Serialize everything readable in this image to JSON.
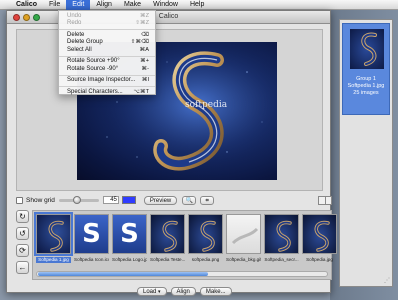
{
  "menubar": {
    "apple": "",
    "app_name": "Calico",
    "items": [
      "File",
      "Edit",
      "Align",
      "Make",
      "Window",
      "Help"
    ],
    "active": "Edit"
  },
  "window": {
    "title": "Calico"
  },
  "edit_menu": {
    "undo": {
      "label": "Undo",
      "shortcut": "⌘Z"
    },
    "redo": {
      "label": "Redo",
      "shortcut": "⇧⌘Z"
    },
    "delete": {
      "label": "Delete",
      "shortcut": "⌫"
    },
    "delete_group": {
      "label": "Delete Group",
      "shortcut": "⇧⌘⌫"
    },
    "select_all": {
      "label": "Select All",
      "shortcut": "⌘A"
    },
    "rotate_plus": {
      "label": "Rotate Source +90°",
      "shortcut": "⌘+"
    },
    "rotate_minus": {
      "label": "Rotate Source -90°",
      "shortcut": "⌘-"
    },
    "inspector": {
      "label": "Source Image Inspector...",
      "shortcut": "⌘I"
    },
    "special_chars": {
      "label": "Special Characters...",
      "shortcut": "⌥⌘T"
    }
  },
  "preview": {
    "watermark": "softpedia",
    "letter": "S"
  },
  "toolbar": {
    "show_grid_label": "Show grid",
    "grid_size": "45",
    "grid_slider_fraction": 0.45,
    "grid_color": "#2f3cff",
    "preview_label": "Preview",
    "zoom_icon": "🔍",
    "crop_icon": "⌗"
  },
  "side_buttons": [
    "↻",
    "↺",
    "⟳",
    "←"
  ],
  "thumbnails": [
    {
      "caption": "Softpedia 1.jpg",
      "selected": true,
      "kind": "swirl"
    },
    {
      "caption": "Softpedia Icon.ico",
      "selected": false,
      "kind": "letter"
    },
    {
      "caption": "Softpedia Logo.jpg",
      "selected": false,
      "kind": "letter"
    },
    {
      "caption": "Softpedia Teste...",
      "selected": false,
      "kind": "dark"
    },
    {
      "caption": "softpedia.png",
      "selected": false,
      "kind": "dark"
    },
    {
      "caption": "Softpedia_bkg.gif",
      "selected": false,
      "kind": "light"
    },
    {
      "caption": "Softpedia_secr...",
      "selected": false,
      "kind": "dark"
    },
    {
      "caption": "Softpedia.jpg",
      "selected": false,
      "kind": "dark"
    }
  ],
  "bottom_buttons": {
    "load": "Load",
    "align": "Align",
    "make": "Make..."
  },
  "group_panel": {
    "name": "Group 1",
    "file": "Softpedia 1.jpg",
    "count": "25 images"
  }
}
